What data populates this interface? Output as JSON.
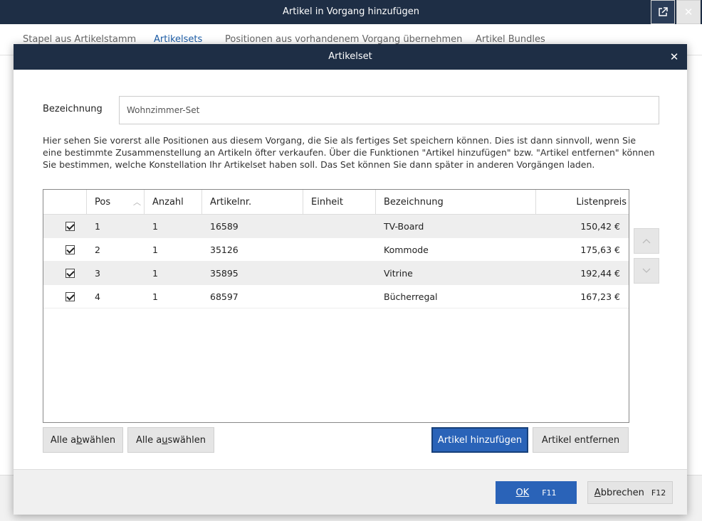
{
  "window": {
    "title": "Artikel in Vorgang hinzufügen",
    "popout_icon": "popout-icon",
    "close_icon": "close-icon"
  },
  "tabs": [
    {
      "label": "Stapel aus Artikelstamm",
      "active": false
    },
    {
      "label": "Artikelsets",
      "active": true
    },
    {
      "label": "Positionen aus vorhandenem Vorgang übernehmen",
      "active": false
    },
    {
      "label": "Artikel Bundles",
      "active": false
    }
  ],
  "dialog": {
    "title": "Artikelset",
    "field_label": "Bezeichnung",
    "field_value": "Wohnzimmer-Set",
    "description": "Hier sehen Sie vorerst alle Positionen aus diesem Vorgang, die Sie als fertiges Set speichern können. Dies ist dann sinnvoll, wenn Sie eine bestimmte Zusammenstellung an Artikeln öfter verkaufen. Über die Funktionen \"Artikel hinzufügen\" bzw. \"Artikel entfernen\" können Sie bestimmen, welche Konstellation Ihr Artikelset haben soll. Das Set können Sie dann später in anderen Vorgängen laden.",
    "columns": [
      "Pos",
      "Anzahl",
      "Artikelnr.",
      "Einheit",
      "Bezeichnung",
      "Listenpreis"
    ],
    "rows": [
      {
        "checked": true,
        "pos": "1",
        "anzahl": "1",
        "artikelnr": "16589",
        "einheit": "",
        "bezeichnung": "TV-Board",
        "listenpreis": "150,42 €"
      },
      {
        "checked": true,
        "pos": "2",
        "anzahl": "1",
        "artikelnr": "35126",
        "einheit": "",
        "bezeichnung": "Kommode",
        "listenpreis": "175,63 €"
      },
      {
        "checked": true,
        "pos": "3",
        "anzahl": "1",
        "artikelnr": "35895",
        "einheit": "",
        "bezeichnung": "Vitrine",
        "listenpreis": "192,44 €"
      },
      {
        "checked": true,
        "pos": "4",
        "anzahl": "1",
        "artikelnr": "68597",
        "einheit": "",
        "bezeichnung": "Bücherregal",
        "listenpreis": "167,23 €"
      }
    ],
    "buttons": {
      "deselect_all": {
        "pre": "Alle a",
        "u": "b",
        "post": "wählen"
      },
      "select_all": {
        "pre": "Alle a",
        "u": "u",
        "post": "swählen"
      },
      "add_article": "Artikel hinzufügen",
      "remove_article": "Artikel entfernen",
      "ok": "OK",
      "ok_key": "F11",
      "cancel_u": "A",
      "cancel_rest": "bbrechen",
      "cancel_key": "F12"
    }
  }
}
